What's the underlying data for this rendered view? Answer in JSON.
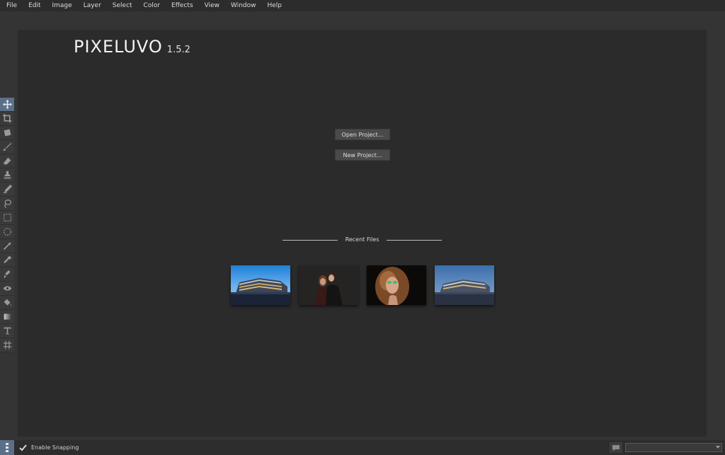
{
  "menu": [
    "File",
    "Edit",
    "Image",
    "Layer",
    "Select",
    "Color",
    "Effects",
    "View",
    "Window",
    "Help"
  ],
  "logo": {
    "name": "PIXELUVO",
    "version": "1.5.2"
  },
  "start": {
    "open_label": "Open Project...",
    "new_label": "New Project...",
    "recent_label": "Recent Files"
  },
  "recent_files": [
    {
      "icon": "building-photo"
    },
    {
      "icon": "couple-photo"
    },
    {
      "icon": "portrait-photo"
    },
    {
      "icon": "building-photo"
    }
  ],
  "tools": [
    {
      "icon": "move-icon",
      "active": true
    },
    {
      "icon": "crop-icon"
    },
    {
      "icon": "transform-icon"
    },
    {
      "icon": "brush-icon"
    },
    {
      "icon": "eraser-icon"
    },
    {
      "icon": "clone-stamp-icon"
    },
    {
      "icon": "pen-icon"
    },
    {
      "icon": "lasso-icon"
    },
    {
      "icon": "rect-select-icon"
    },
    {
      "icon": "ellipse-select-icon"
    },
    {
      "icon": "magic-wand-icon"
    },
    {
      "icon": "color-picker-icon"
    },
    {
      "icon": "smudge-icon"
    },
    {
      "icon": "eye-icon"
    },
    {
      "icon": "fill-icon"
    },
    {
      "icon": "gradient-icon"
    },
    {
      "icon": "text-icon"
    },
    {
      "icon": "hash-icon"
    }
  ],
  "status": {
    "snapping_label": "Enable Snapping",
    "snapping_checked": true
  },
  "colors": {
    "accent": "#5c6f88",
    "background": "#343434",
    "workspace": "#2b2b2b"
  }
}
